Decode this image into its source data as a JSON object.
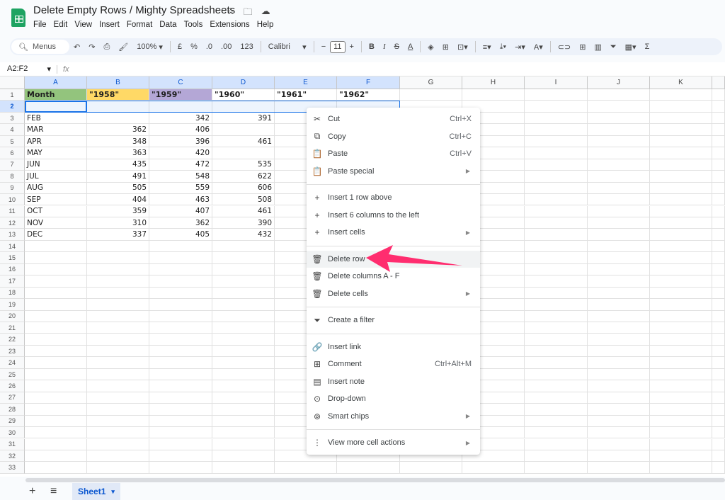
{
  "app": {
    "title": "Delete Empty Rows / Mighty Spreadsheets",
    "menu": [
      "File",
      "Edit",
      "View",
      "Insert",
      "Format",
      "Data",
      "Tools",
      "Extensions",
      "Help"
    ],
    "title_icons": [
      "star-icon",
      "move-folder-icon",
      "cloud-saved-icon"
    ]
  },
  "toolbar": {
    "search": "Menus",
    "zoom": "100%",
    "currency": "£",
    "percent": "%",
    "dec_decrease": ".0",
    "dec_increase": ".00",
    "format_123": "123",
    "font": "Calibri",
    "font_size": "11"
  },
  "formula_bar": {
    "name_box": "A2:F2",
    "fx": "fx",
    "value": ""
  },
  "columns": [
    "A",
    "B",
    "C",
    "D",
    "E",
    "F",
    "G",
    "H",
    "I",
    "J",
    "K"
  ],
  "selected_columns": [
    "A",
    "B",
    "C",
    "D",
    "E",
    "F"
  ],
  "header_row": {
    "A": "Month",
    "B": "\"1958\"",
    "C": "\"1959\"",
    "D": "\"1960\"",
    "E": "\"1961\"",
    "F": "\"1962\"",
    "colors": {
      "A": "#93c47d",
      "B": "#ffd966",
      "C": "#b4a7d6"
    }
  },
  "rows": [
    {
      "n": 3,
      "A": "FEB",
      "B": "",
      "C": "342",
      "D": "391"
    },
    {
      "n": 4,
      "A": "MAR",
      "B": "362",
      "C": "406",
      "D": ""
    },
    {
      "n": 5,
      "A": "APR",
      "B": "348",
      "C": "396",
      "D": "461"
    },
    {
      "n": 6,
      "A": "MAY",
      "B": "363",
      "C": "420",
      "D": ""
    },
    {
      "n": 7,
      "A": "JUN",
      "B": "435",
      "C": "472",
      "D": "535"
    },
    {
      "n": 8,
      "A": "JUL",
      "B": "491",
      "C": "548",
      "D": "622"
    },
    {
      "n": 9,
      "A": "AUG",
      "B": "505",
      "C": "559",
      "D": "606"
    },
    {
      "n": 10,
      "A": "SEP",
      "B": "404",
      "C": "463",
      "D": "508"
    },
    {
      "n": 11,
      "A": "OCT",
      "B": "359",
      "C": "407",
      "D": "461"
    },
    {
      "n": 12,
      "A": "NOV",
      "B": "310",
      "C": "362",
      "D": "390"
    },
    {
      "n": 13,
      "A": "DEC",
      "B": "337",
      "C": "405",
      "D": "432"
    }
  ],
  "row_count": 33,
  "selected_row": 2,
  "context_menu": {
    "items": [
      {
        "label": "Cut",
        "shortcut": "Ctrl+X",
        "icon": "scissors-icon",
        "glyph": "✂"
      },
      {
        "label": "Copy",
        "shortcut": "Ctrl+C",
        "icon": "copy-icon",
        "glyph": "⧉"
      },
      {
        "label": "Paste",
        "shortcut": "Ctrl+V",
        "icon": "clipboard-icon",
        "glyph": "📋"
      },
      {
        "label": "Paste special",
        "submenu": true,
        "icon": "clipboard-icon",
        "glyph": "📋"
      },
      {
        "sep": true
      },
      {
        "label": "Insert 1 row above",
        "icon": "plus-icon",
        "glyph": "+"
      },
      {
        "label": "Insert 6 columns to the left",
        "icon": "plus-icon",
        "glyph": "+"
      },
      {
        "label": "Insert cells",
        "submenu": true,
        "icon": "plus-icon",
        "glyph": "+"
      },
      {
        "sep": true
      },
      {
        "label": "Delete row",
        "icon": "trash-icon",
        "glyph": "🗑",
        "highlighted": true
      },
      {
        "label": "Delete columns A - F",
        "icon": "trash-icon",
        "glyph": "🗑"
      },
      {
        "label": "Delete cells",
        "submenu": true,
        "icon": "trash-icon",
        "glyph": "🗑"
      },
      {
        "sep": true
      },
      {
        "label": "Create a filter",
        "icon": "filter-icon",
        "glyph": "⏷"
      },
      {
        "sep": true
      },
      {
        "label": "Insert link",
        "icon": "link-icon",
        "glyph": "🔗"
      },
      {
        "label": "Comment",
        "shortcut": "Ctrl+Alt+M",
        "icon": "comment-icon",
        "glyph": "⊞"
      },
      {
        "label": "Insert note",
        "icon": "note-icon",
        "glyph": "▤"
      },
      {
        "label": "Drop-down",
        "icon": "dropdown-circle-icon",
        "glyph": "⊙"
      },
      {
        "label": "Smart chips",
        "submenu": true,
        "icon": "smart-chips-icon",
        "glyph": "⊚"
      },
      {
        "sep": true
      },
      {
        "label": "View more cell actions",
        "submenu": true,
        "icon": "more-vert-icon",
        "glyph": "⋮"
      }
    ]
  },
  "annotation": {
    "arrow_color": "#ff2d6f",
    "points_to": "Delete row"
  },
  "sheets": [
    {
      "name": "Sheet1",
      "active": true
    }
  ],
  "bottom": {
    "add": "+",
    "list": "≡"
  }
}
